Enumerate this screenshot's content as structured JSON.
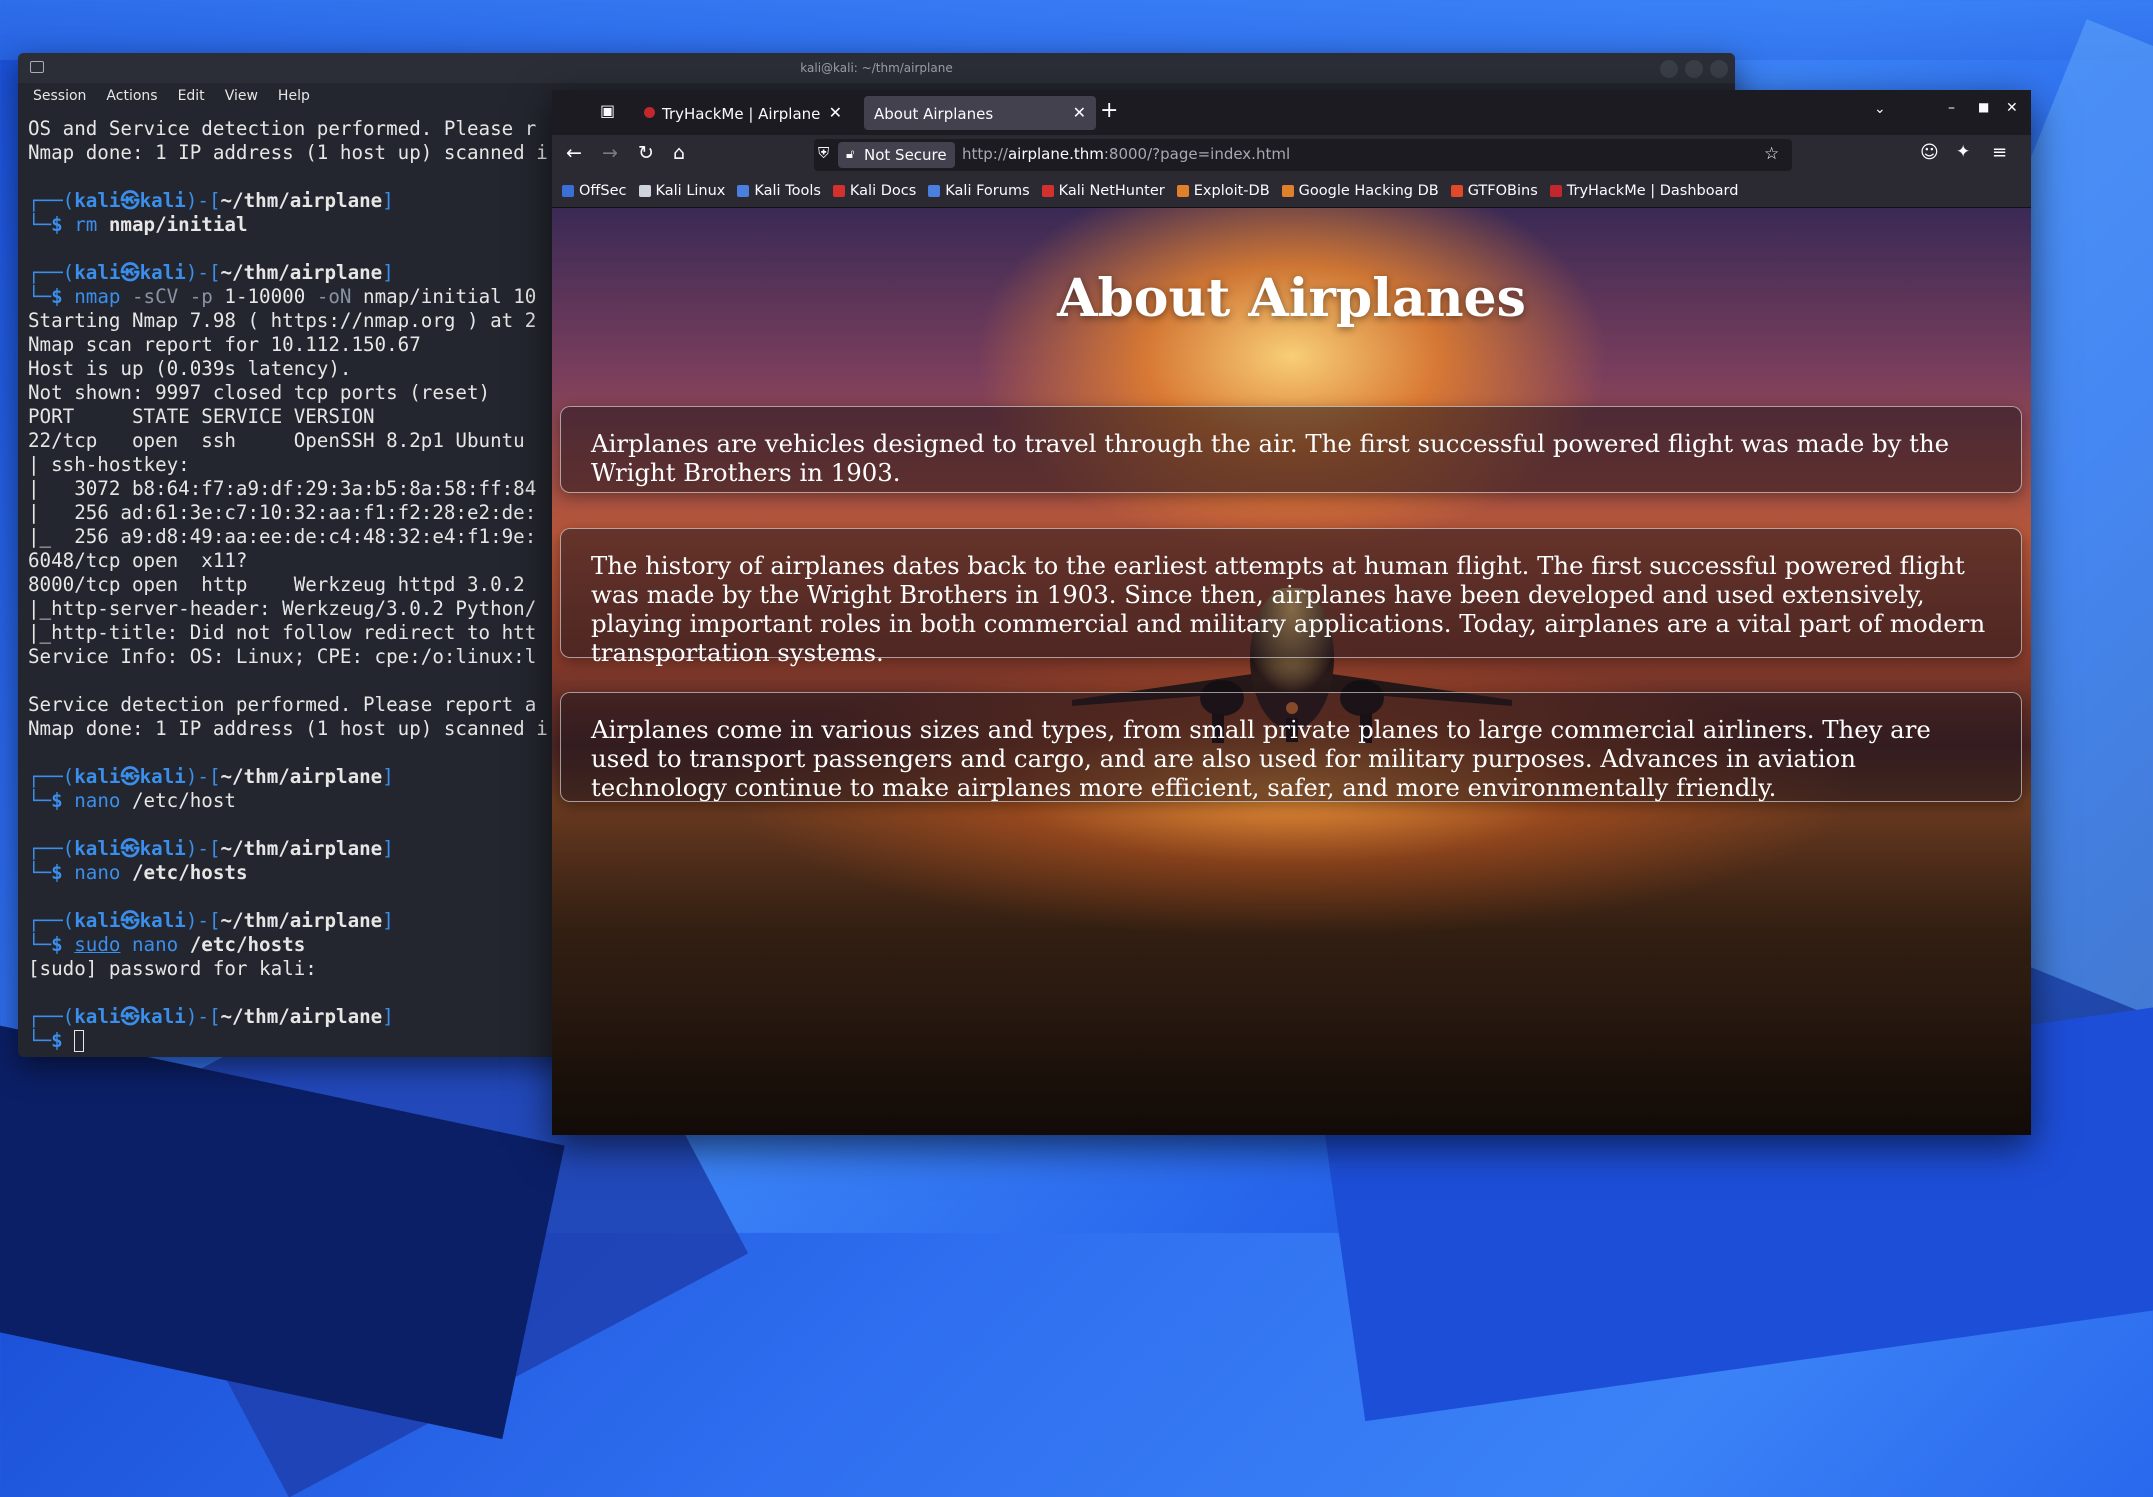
{
  "terminal": {
    "title": "kali@kali: ~/thm/airplane",
    "menu": [
      "Session",
      "Actions",
      "Edit",
      "View",
      "Help"
    ],
    "prompt_user": "kali",
    "prompt_host": "kali",
    "prompt_path": "~/thm/airplane",
    "lines": [
      {
        "type": "out",
        "text": "OS and Service detection performed. Please r"
      },
      {
        "type": "out",
        "text": "Nmap done: 1 IP address (1 host up) scanned i"
      },
      {
        "type": "blank"
      },
      {
        "type": "prompt"
      },
      {
        "type": "cmd",
        "parts": [
          {
            "t": "rm ",
            "c": "cmd"
          },
          {
            "t": "nmap/initial",
            "c": "bold"
          }
        ]
      },
      {
        "type": "blank"
      },
      {
        "type": "prompt"
      },
      {
        "type": "cmd",
        "parts": [
          {
            "t": "nmap ",
            "c": "cmd"
          },
          {
            "t": "-sCV -p ",
            "c": "muted"
          },
          {
            "t": "1-10000 ",
            "c": ""
          },
          {
            "t": "-oN ",
            "c": "muted"
          },
          {
            "t": "nmap/initial 10",
            "c": ""
          }
        ]
      },
      {
        "type": "out",
        "text": "Starting Nmap 7.98 ( https://nmap.org ) at 2"
      },
      {
        "type": "out",
        "text": "Nmap scan report for 10.112.150.67"
      },
      {
        "type": "out",
        "text": "Host is up (0.039s latency)."
      },
      {
        "type": "out",
        "text": "Not shown: 9997 closed tcp ports (reset)"
      },
      {
        "type": "out",
        "text": "PORT     STATE SERVICE VERSION"
      },
      {
        "type": "out",
        "text": "22/tcp   open  ssh     OpenSSH 8.2p1 Ubuntu "
      },
      {
        "type": "out",
        "text": "| ssh-hostkey:"
      },
      {
        "type": "out",
        "text": "|   3072 b8:64:f7:a9:df:29:3a:b5:8a:58:ff:84"
      },
      {
        "type": "out",
        "text": "|   256 ad:61:3e:c7:10:32:aa:f1:f2:28:e2:de:"
      },
      {
        "type": "out",
        "text": "|_  256 a9:d8:49:aa:ee:de:c4:48:32:e4:f1:9e:"
      },
      {
        "type": "out",
        "text": "6048/tcp open  x11?"
      },
      {
        "type": "out",
        "text": "8000/tcp open  http    Werkzeug httpd 3.0.2 "
      },
      {
        "type": "out",
        "text": "|_http-server-header: Werkzeug/3.0.2 Python/"
      },
      {
        "type": "out",
        "text": "|_http-title: Did not follow redirect to htt"
      },
      {
        "type": "out",
        "text": "Service Info: OS: Linux; CPE: cpe:/o:linux:l"
      },
      {
        "type": "blank"
      },
      {
        "type": "out",
        "text": "Service detection performed. Please report a"
      },
      {
        "type": "out",
        "text": "Nmap done: 1 IP address (1 host up) scanned i"
      },
      {
        "type": "blank"
      },
      {
        "type": "prompt"
      },
      {
        "type": "cmd",
        "parts": [
          {
            "t": "nano ",
            "c": "cmd"
          },
          {
            "t": "/etc/host",
            "c": ""
          }
        ]
      },
      {
        "type": "blank"
      },
      {
        "type": "prompt"
      },
      {
        "type": "cmd",
        "parts": [
          {
            "t": "nano ",
            "c": "cmd"
          },
          {
            "t": "/etc/hosts",
            "c": "bold"
          }
        ]
      },
      {
        "type": "blank"
      },
      {
        "type": "prompt"
      },
      {
        "type": "cmd",
        "parts": [
          {
            "t": "sudo",
            "c": "cmd-u"
          },
          {
            "t": " nano ",
            "c": "cmd"
          },
          {
            "t": "/etc/hosts",
            "c": "bold"
          }
        ]
      },
      {
        "type": "out",
        "text": "[sudo] password for kali:"
      },
      {
        "type": "blank"
      },
      {
        "type": "prompt"
      },
      {
        "type": "cursor"
      }
    ]
  },
  "browser": {
    "tabs": [
      {
        "label": "TryHackMe | Airplane",
        "active": false
      },
      {
        "label": "About Airplanes",
        "active": true
      }
    ],
    "new_tab": "+",
    "security_label": "Not Secure",
    "url_prefix": "http://",
    "url_host": "airplane.thm",
    "url_rest": ":8000/?page=index.html",
    "bookmarks": [
      {
        "label": "OffSec",
        "color": "#3b6fd8"
      },
      {
        "label": "Kali Linux",
        "color": "#cfd3dc"
      },
      {
        "label": "Kali Tools",
        "color": "#4a7fe0"
      },
      {
        "label": "Kali Docs",
        "color": "#d4302e"
      },
      {
        "label": "Kali Forums",
        "color": "#4a7fe0"
      },
      {
        "label": "Kali NetHunter",
        "color": "#d4302e"
      },
      {
        "label": "Exploit-DB",
        "color": "#e0802a"
      },
      {
        "label": "Google Hacking DB",
        "color": "#e0802a"
      },
      {
        "label": "GTFOBins",
        "color": "#e04a2a"
      },
      {
        "label": "TryHackMe | Dashboard",
        "color": "#c1272d"
      }
    ]
  },
  "page": {
    "heading": "About Airplanes",
    "paragraphs": [
      "Airplanes are vehicles designed to travel through the air. The first successful powered flight was made by the Wright Brothers in 1903.",
      "The history of airplanes dates back to the earliest attempts at human flight. The first successful powered flight was made by the Wright Brothers in 1903. Since then, airplanes have been developed and used extensively, playing important roles in both commercial and military applications. Today, airplanes are a vital part of modern transportation systems.",
      "Airplanes come in various sizes and types, from small private planes to large commercial airliners. They are used to transport passengers and cargo, and are also used for military purposes. Advances in aviation technology continue to make airplanes more efficient, safer, and more environmentally friendly."
    ]
  }
}
